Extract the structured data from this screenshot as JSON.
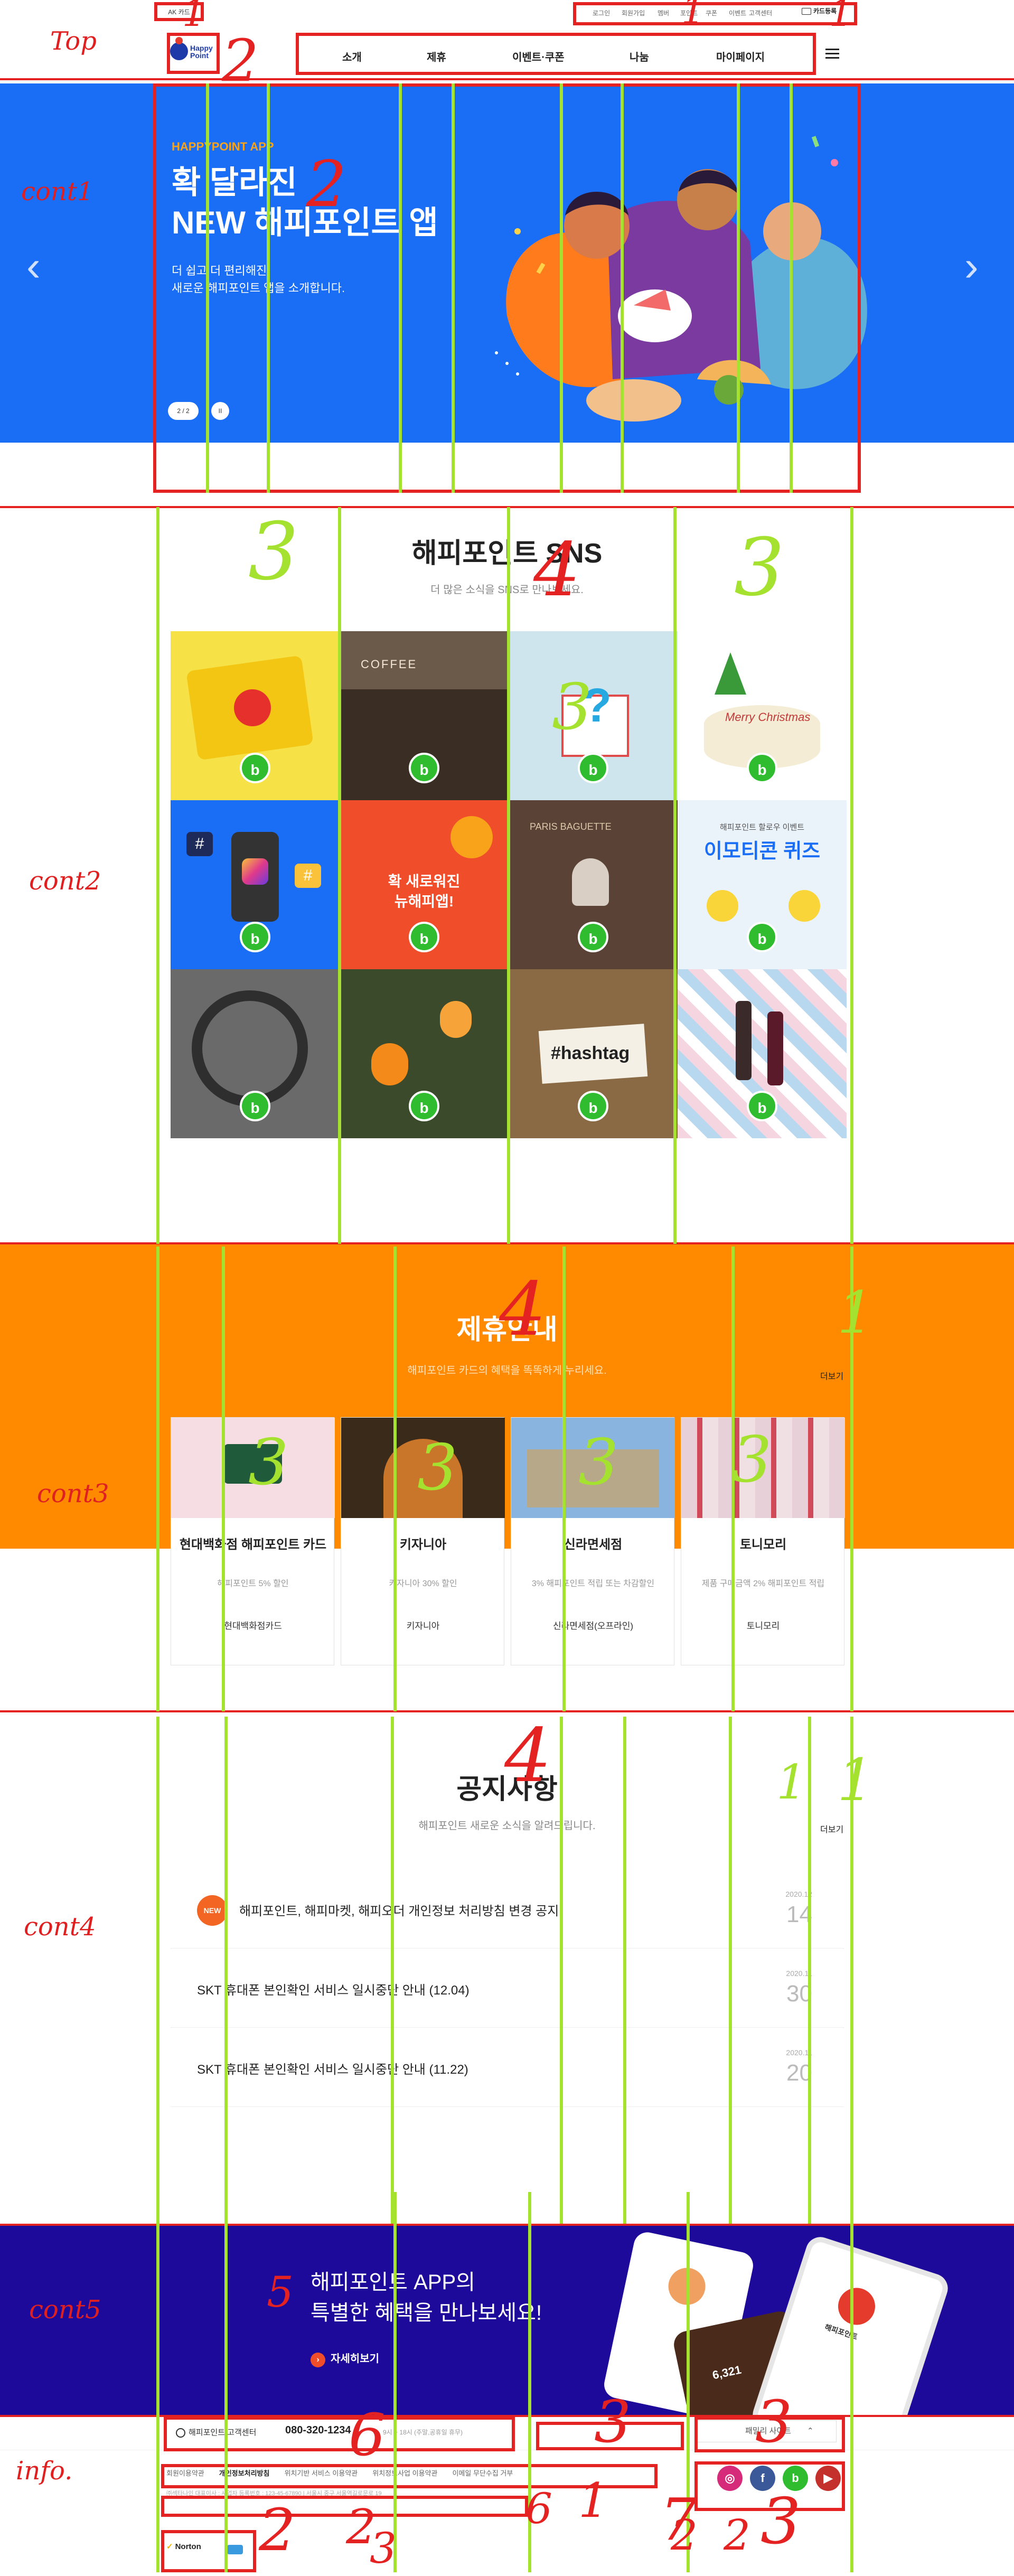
{
  "annotations": {
    "labels": [
      "Top",
      "cont1",
      "cont2",
      "cont3",
      "cont4",
      "cont5",
      "info."
    ],
    "numbers": [
      "1",
      "2",
      "1",
      "1",
      "2",
      "3",
      "3",
      "3",
      "4",
      "4",
      "1",
      "3",
      "3",
      "3",
      "3",
      "4",
      "1",
      "1",
      "5",
      "6",
      "3",
      "3",
      "2",
      "2",
      "1",
      "3",
      "6",
      "7",
      "2",
      "2",
      "3"
    ]
  },
  "header": {
    "ak_badge": "AK 카드",
    "util": [
      "로그인",
      "회원가입",
      "멤버",
      "포인트",
      "쿠폰",
      "이벤트",
      "고객센터"
    ],
    "card_register": "카드등록",
    "logo_text": "Happy Point",
    "nav": [
      "소개",
      "제휴",
      "이벤트·쿠폰",
      "나눔",
      "마이페이지"
    ],
    "menu_icon": "hamburger-icon"
  },
  "hero": {
    "kicker": "HAPPYPOINT APP",
    "title_line1": "확 달라진",
    "title_line2": "NEW 해피포인트 앱",
    "desc_line1": "더 쉽고 더 편리해진",
    "desc_line2": "새로운 해피포인트 앱을 소개합니다.",
    "pager": "2 / 2",
    "pause": "II",
    "prev": "‹",
    "next": "›"
  },
  "sns": {
    "title": "해피포인트 SNS",
    "subtitle": "더 많은 소식을 SNS로 만나보세요.",
    "tile_text": {
      "coffee": "COFFEE",
      "renewal_line1": "확 새로워진",
      "renewal_line2": "뉴해피앱!",
      "quiz_small": "해피포인트 할로우 이벤트",
      "quiz_big": "이모티콘 퀴즈",
      "cake": "Merry Christmas",
      "hashtag": "#hashtag",
      "bakery": "PARIS BAGUETTE"
    },
    "badge": "b"
  },
  "partner": {
    "title": "제휴안내",
    "subtitle": "해피포인트 카드의 혜택을 똑똑하게 누리세요.",
    "more": "더보기",
    "cards": [
      {
        "name": "현대백화점 해피포인트 카드",
        "desc": "해피포인트 5% 할인",
        "brand": "현대백화점카드"
      },
      {
        "name": "키자니아",
        "desc": "키자니아 30% 할인",
        "brand": "키자니아"
      },
      {
        "name": "신라면세점",
        "desc": "3% 해피포인트 적립 또는 차감할인",
        "brand": "신라면세점(오프라인)"
      },
      {
        "name": "토니모리",
        "desc": "제품 구매금액 2% 해피포인트 적립",
        "brand": "토니모리"
      }
    ]
  },
  "notice": {
    "title": "공지사항",
    "subtitle": "해피포인트 새로운 소식을 알려드립니다.",
    "more": "더보기",
    "new_badge": "NEW",
    "items": [
      {
        "text": "해피포인트, 해피마켓, 해피오더 개인정보 처리방침 변경 공지",
        "month": "2020.12",
        "day": "14"
      },
      {
        "text": "SKT 휴대폰 본인확인 서비스 일시중단 안내 (12.04)",
        "month": "2020.11",
        "day": "30"
      },
      {
        "text": "SKT 휴대폰 본인확인 서비스 일시중단 안내 (11.22)",
        "month": "2020.11",
        "day": "20"
      }
    ]
  },
  "app_banner": {
    "line1": "해피포인트 APP의",
    "line2": "특별한 혜택을 만나보세요!",
    "cta": "자세히보기",
    "phone_label": "해피포인트",
    "phone_amount": "6,321"
  },
  "footer": {
    "cs_label": "해피포인트 고객센터",
    "cs_phone": "080-320-1234",
    "cs_hours": "9시 ~ 18시 (주말,공휴일 휴무)",
    "family_site": "패밀리 사이트",
    "links": [
      "회원이용약관",
      "개인정보처리방침",
      "위치기반 서비스 이용약관",
      "위치정보사업 이용약관",
      "이메일 무단수집 거부"
    ],
    "company": "㈜섹타나인 대표이사 : 사업자 등록번호 : 123-45-67890 | 서울시 중구 서울역길로문로 19",
    "norton": "Norton"
  }
}
